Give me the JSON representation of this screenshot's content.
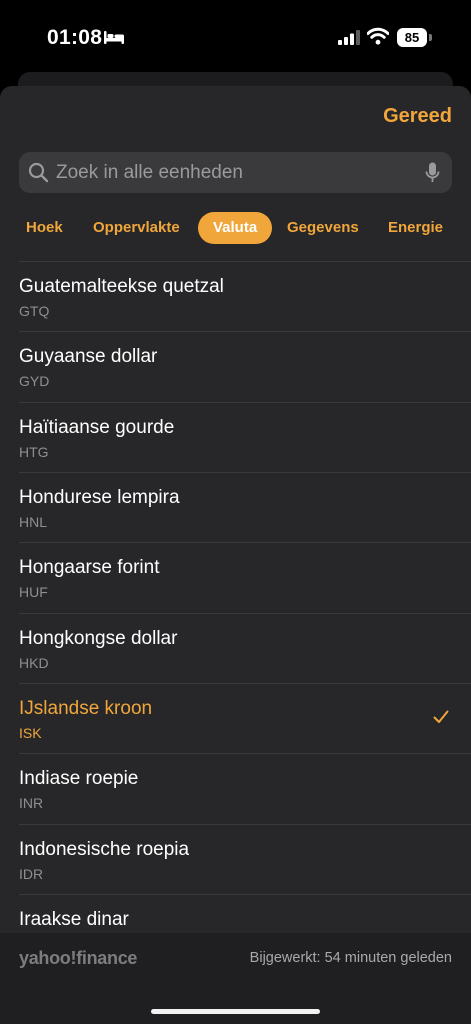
{
  "status_bar": {
    "time": "01:08",
    "battery": "85",
    "icons": [
      "bed-icon",
      "cellular-signal-icon",
      "wifi-icon",
      "battery-icon"
    ]
  },
  "header": {
    "done_label": "Gereed"
  },
  "search": {
    "placeholder": "Zoek in alle eenheden",
    "value": "",
    "icons": [
      "search-icon",
      "microphone-icon"
    ]
  },
  "tabs": [
    {
      "label": "Hoek",
      "active": false
    },
    {
      "label": "Oppervlakte",
      "active": false
    },
    {
      "label": "Valuta",
      "active": true
    },
    {
      "label": "Gegevens",
      "active": false
    },
    {
      "label": "Energie",
      "active": false
    }
  ],
  "currencies": [
    {
      "name": "Guatemalteekse quetzal",
      "code": "GTQ",
      "selected": false
    },
    {
      "name": "Guyaanse dollar",
      "code": "GYD",
      "selected": false
    },
    {
      "name": "Haïtiaanse gourde",
      "code": "HTG",
      "selected": false
    },
    {
      "name": "Hondurese lempira",
      "code": "HNL",
      "selected": false
    },
    {
      "name": "Hongaarse forint",
      "code": "HUF",
      "selected": false
    },
    {
      "name": "Hongkongse dollar",
      "code": "HKD",
      "selected": false
    },
    {
      "name": "IJslandse kroon",
      "code": "ISK",
      "selected": true
    },
    {
      "name": "Indiase roepie",
      "code": "INR",
      "selected": false
    },
    {
      "name": "Indonesische roepia",
      "code": "IDR",
      "selected": false
    },
    {
      "name": "Iraakse dinar",
      "code": "",
      "selected": false
    }
  ],
  "colors": {
    "accent": "#f0a63a",
    "sheet_background": "#272729",
    "search_background": "#3a3a3d",
    "secondary_text": "#8e8e93"
  },
  "footer": {
    "logo_text": "yahoo!finance",
    "updated": "Bijgewerkt: 54 minuten geleden"
  }
}
